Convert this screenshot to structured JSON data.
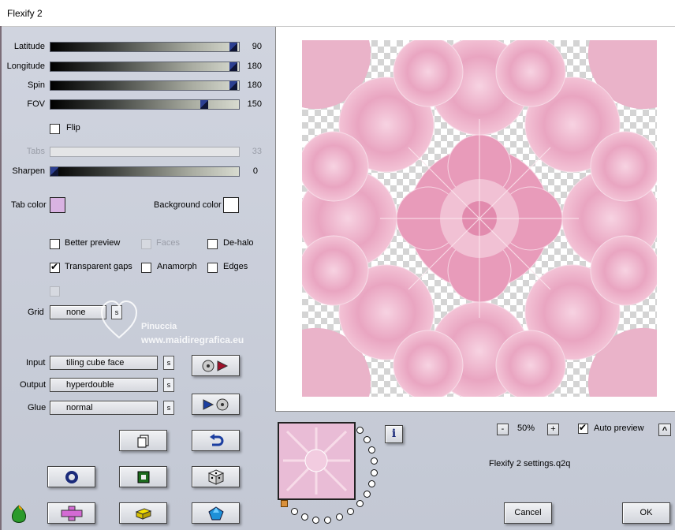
{
  "window": {
    "title": "Flexify 2"
  },
  "sliders": [
    {
      "label": "Latitude",
      "value": "90",
      "level": 1.0,
      "enabled": true
    },
    {
      "label": "Longitude",
      "value": "180",
      "level": 1.0,
      "enabled": true
    },
    {
      "label": "Spin",
      "value": "180",
      "level": 1.0,
      "enabled": true
    },
    {
      "label": "FOV",
      "value": "150",
      "level": 0.83,
      "enabled": true
    },
    {
      "label": "Tabs",
      "value": "33",
      "level": 0.33,
      "enabled": false
    },
    {
      "label": "Sharpen",
      "value": "0",
      "level": 0.0,
      "enabled": true
    }
  ],
  "flip": {
    "label": "Flip",
    "checked": false
  },
  "tab_color": {
    "label": "Tab color",
    "color": "#d9b3e2"
  },
  "background_color": {
    "label": "Background color",
    "color": "#ffffff"
  },
  "options": {
    "better_preview": {
      "label": "Better preview",
      "checked": false
    },
    "faces": {
      "label": "Faces",
      "checked": false
    },
    "dehalo": {
      "label": "De-halo",
      "checked": false
    },
    "transparent_gaps": {
      "label": "Transparent gaps",
      "checked": true
    },
    "anamorph": {
      "label": "Anamorph",
      "checked": false
    },
    "edges": {
      "label": "Edges",
      "checked": false
    }
  },
  "grid": {
    "label": "Grid",
    "value": "none"
  },
  "watermark": {
    "line1": "Pinuccia",
    "line2": "www.maidiregrafica.eu"
  },
  "input": {
    "label": "Input",
    "value": "tiling cube face"
  },
  "output": {
    "label": "Output",
    "value": "hyperdouble"
  },
  "glue": {
    "label": "Glue",
    "value": "normal"
  },
  "zoom": {
    "minus": "-",
    "value": "50%",
    "plus": "+"
  },
  "auto_preview": {
    "label": "Auto preview",
    "checked": true
  },
  "settings_file": "Flexify 2 settings.q2q",
  "buttons": {
    "cancel": "Cancel",
    "ok": "OK",
    "info": "i",
    "up": "^"
  },
  "colors": {
    "pink_light": "#f2c6d8",
    "pink_mid": "#e8a0bd",
    "pink_dark": "#d97aa3",
    "accent_blue": "#2c3f91"
  }
}
